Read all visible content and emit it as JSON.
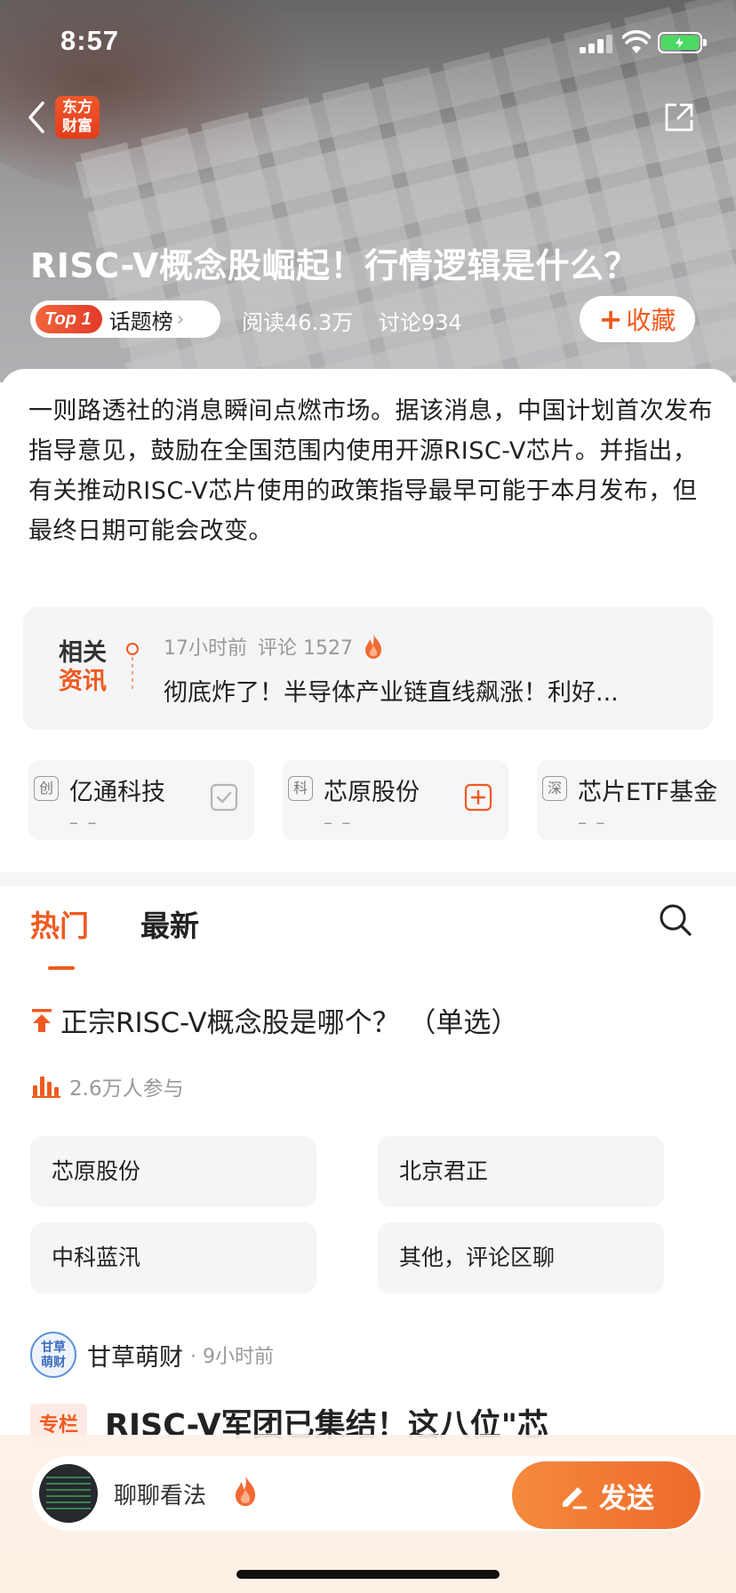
{
  "status_bar": {
    "time": "8:57"
  },
  "header": {
    "logo_text": "东方财富"
  },
  "topic": {
    "title": "RISC-V概念股崛起！行情逻辑是什么？",
    "rank_badge": "Top 1",
    "rank_label": "话题榜",
    "reads": "阅读46.3万",
    "discussions": "讨论934",
    "favorite_label": "收藏"
  },
  "description": "一则路透社的消息瞬间点燃市场。据该消息，中国计划首次发布指导意见，鼓励在全国范围内使用开源RISC-V芯片。并指出，有关推动RISC-V芯片使用的政策指导最早可能于本月发布，但最终日期可能会改变。",
  "related_news": {
    "tag_line1": "相关",
    "tag_line2": "资讯",
    "time": "17小时前",
    "comments": "评论 1527",
    "headline": "彻底炸了！半导体产业链直线飙涨！利好..."
  },
  "stocks": [
    {
      "market": "创",
      "name": "亿通科技",
      "price": "– –",
      "action": "check-icon"
    },
    {
      "market": "科",
      "name": "芯原股份",
      "price": "– –",
      "action": "add-icon"
    },
    {
      "market": "深",
      "name": "芯片ETF基金",
      "price": "– –",
      "action": "none"
    }
  ],
  "tabs": [
    {
      "label": "热门",
      "active": true
    },
    {
      "label": "最新",
      "active": false
    }
  ],
  "poll": {
    "question": "正宗RISC-V概念股是哪个？ （单选）",
    "participants": "2.6万人参与",
    "options": [
      "芯原股份",
      "北京君正",
      "中科蓝汛",
      "其他，评论区聊"
    ]
  },
  "post": {
    "author_avatar_text": "甘草萌财",
    "author": "甘草萌财",
    "time": "· 9小时前",
    "column_tag": "专栏",
    "title": "RISC-V军团已集结！这八位\"芯"
  },
  "bottom_bar": {
    "placeholder": "聊聊看法",
    "send_label": "发送"
  },
  "colors": {
    "accent": "#f05a1f",
    "badge_start": "#f2653c",
    "badge_end": "#e23b2a"
  }
}
